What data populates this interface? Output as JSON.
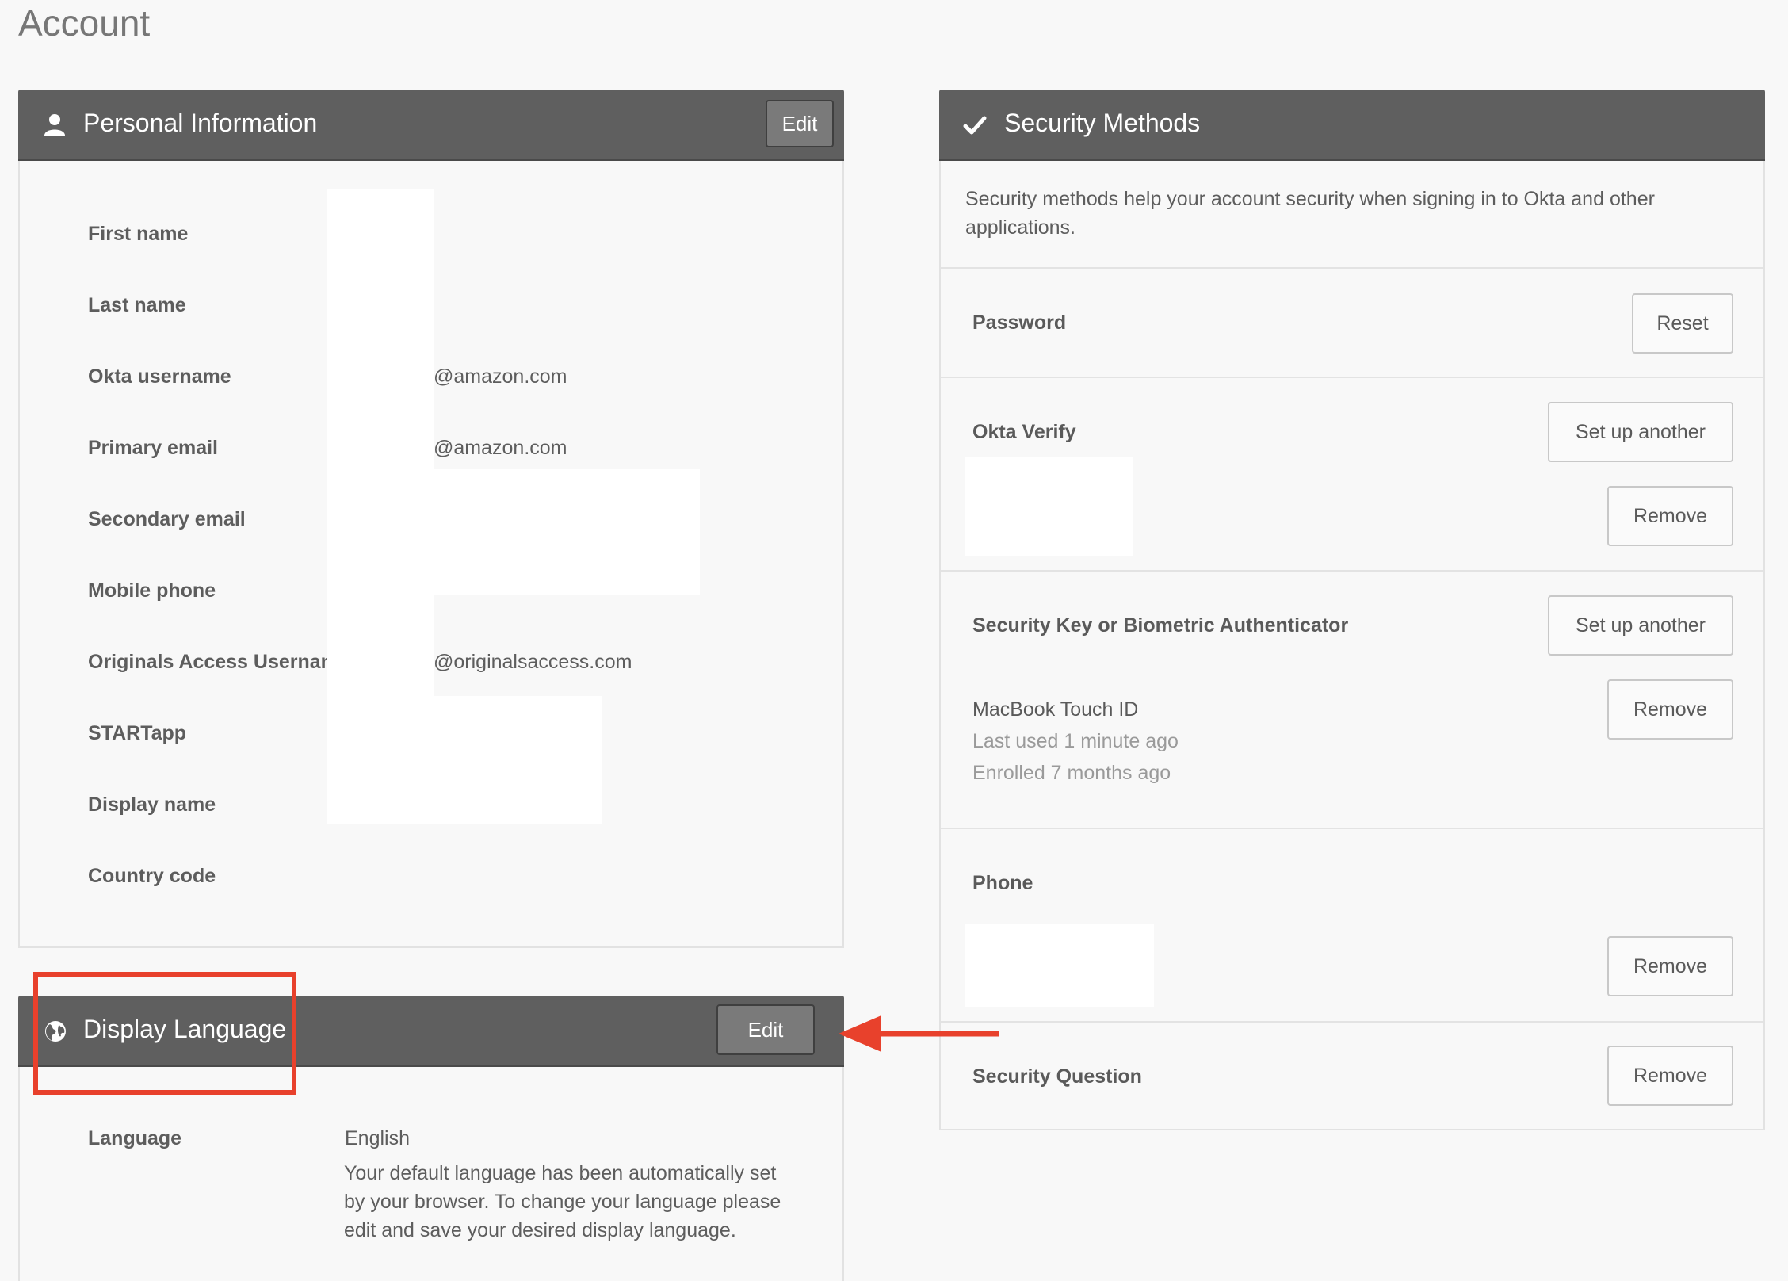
{
  "page": {
    "title": "Account"
  },
  "personal_info": {
    "title": "Personal Information",
    "edit_label": "Edit",
    "fields": [
      {
        "label": "First name",
        "value": ""
      },
      {
        "label": "Last name",
        "value": ""
      },
      {
        "label": "Okta username",
        "value": "@amazon.com"
      },
      {
        "label": "Primary email",
        "value": "@amazon.com"
      },
      {
        "label": "Secondary email",
        "value": ""
      },
      {
        "label": "Mobile phone",
        "value": ""
      },
      {
        "label": "Originals Access Username",
        "value": "@originalsaccess.com"
      },
      {
        "label": "STARTapp",
        "value": ""
      },
      {
        "label": "Display name",
        "value": ""
      },
      {
        "label": "Country code",
        "value": ""
      }
    ]
  },
  "display_language": {
    "title": "Display Language",
    "edit_label": "Edit",
    "language_label": "Language",
    "language_value": "English",
    "note_lines": [
      "Your default language has been automatically set",
      "by your browser. To change your language please",
      "edit and save your desired display language."
    ]
  },
  "security_methods": {
    "title": "Security Methods",
    "description_lines": [
      "Security methods help your account security when signing in to Okta and other",
      "applications."
    ],
    "password": {
      "label": "Password",
      "reset_label": "Reset"
    },
    "okta_verify": {
      "label": "Okta Verify",
      "setup_label": "Set up another",
      "remove_label": "Remove"
    },
    "security_key": {
      "label": "Security Key or Biometric Authenticator",
      "setup_label": "Set up another",
      "remove_label": "Remove",
      "device_name": "MacBook Touch ID",
      "last_used": "Last used 1 minute ago",
      "enrolled": "Enrolled 7 months ago"
    },
    "phone": {
      "label": "Phone",
      "remove_label": "Remove"
    },
    "security_question": {
      "label": "Security Question",
      "remove_label": "Remove"
    }
  },
  "annotation": {
    "highlight_color": "#e8412c"
  }
}
